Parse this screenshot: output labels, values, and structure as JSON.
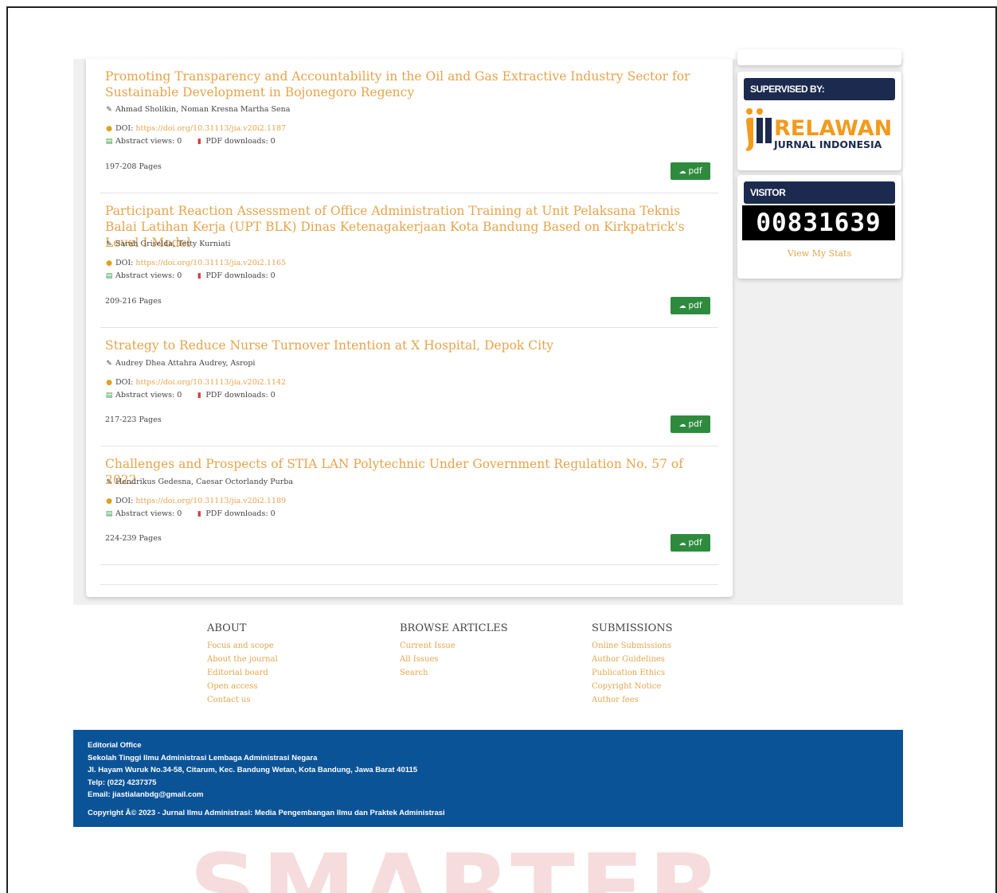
{
  "articles": [
    {
      "title": "Promoting Transparency and Accountability in the Oil and Gas Extractive Industry Sector for Sustainable Development in Bojonegoro Regency",
      "authors": "Ahmad Sholikin, Noman Kresna Martha Sena",
      "doi_label": "DOI:",
      "doi": "https://doi.org/10.31113/jia.v20i2.1187",
      "abstract_views": "Abstract views: 0",
      "pdf_downloads": "PDF downloads: 0",
      "pages": "197-208 Pages",
      "pdf_label": "pdf"
    },
    {
      "title": "Participant Reaction Assessment of Office Administration Training at Unit Pelaksana Teknis Balai Latihan Kerja (UPT BLK) Dinas Ketenagakerjaan Kota Bandung Based on Kirkpatrick's Level I Model",
      "authors": "Sarah Griselda, Tetty Kurniati",
      "doi_label": "DOI:",
      "doi": "https://doi.org/10.31113/jia.v20i2.1165",
      "abstract_views": "Abstract views: 0",
      "pdf_downloads": "PDF downloads: 0",
      "pages": "209-216 Pages",
      "pdf_label": "pdf"
    },
    {
      "title": "Strategy to Reduce Nurse Turnover Intention at X Hospital, Depok City",
      "authors": "Audrey Dhea Attahra Audrey, Asropi",
      "doi_label": "DOI:",
      "doi": "https://doi.org/10.31113/jia.v20i2.1142",
      "abstract_views": "Abstract views: 0",
      "pdf_downloads": "PDF downloads: 0",
      "pages": "217-223 Pages",
      "pdf_label": "pdf"
    },
    {
      "title": "Challenges and Prospects of STIA LAN Polytechnic Under Government Regulation No. 57 of 2022",
      "authors": "Hendrikus Gedesna, Caesar Octorlandy Purba",
      "doi_label": "DOI:",
      "doi": "https://doi.org/10.31113/jia.v20i2.1189",
      "abstract_views": "Abstract views: 0",
      "pdf_downloads": "PDF downloads: 0",
      "pages": "224-239 Pages",
      "pdf_label": "pdf"
    }
  ],
  "sidebar": {
    "supervised_heading": "SUPERVISED BY:",
    "logo_text_main": "RELAWAN",
    "logo_text_sub": "JURNAL INDONESIA",
    "visitor_heading": "VISITOR",
    "visitor_count": "00831639",
    "view_stats": "View My Stats"
  },
  "footer": {
    "about": {
      "heading": "ABOUT",
      "links": [
        "Focus and scope",
        "About the journal",
        "Editorial board",
        "Open access",
        "Contact us"
      ]
    },
    "browse": {
      "heading": "BROWSE ARTICLES",
      "links": [
        "Current Issue",
        "All Issues",
        "Search"
      ]
    },
    "submissions": {
      "heading": "SUBMISSIONS",
      "links": [
        "Online Submissions",
        "Author Guidelines",
        "Publication Ethics",
        "Copyright Notice",
        "Author fees"
      ]
    }
  },
  "bottom": {
    "office": "Editorial Office",
    "institution": "Sekolah Tinggi Ilmu Administrasi Lembaga Administrasi Negara",
    "address": "Jl. Hayam Wuruk No.34-58, Citarum, Kec. Bandung Wetan, Kota Bandung, Jawa Barat 40115",
    "phone": "Telp: (022) 4237375",
    "email": "Email: jiastialanbdg@gmail.com",
    "copyright": "Copyright Â© 2023 - Jurnal Ilmu Administrasi: Media Pengembangan Ilmu dan Praktek Administrasi"
  },
  "watermark": "SMARTER",
  "colors": {
    "link": "#e5a44d",
    "pdf_button": "#2e8b3e",
    "footer_bar": "#0b5397",
    "side_heading": "#1b2a4e"
  }
}
